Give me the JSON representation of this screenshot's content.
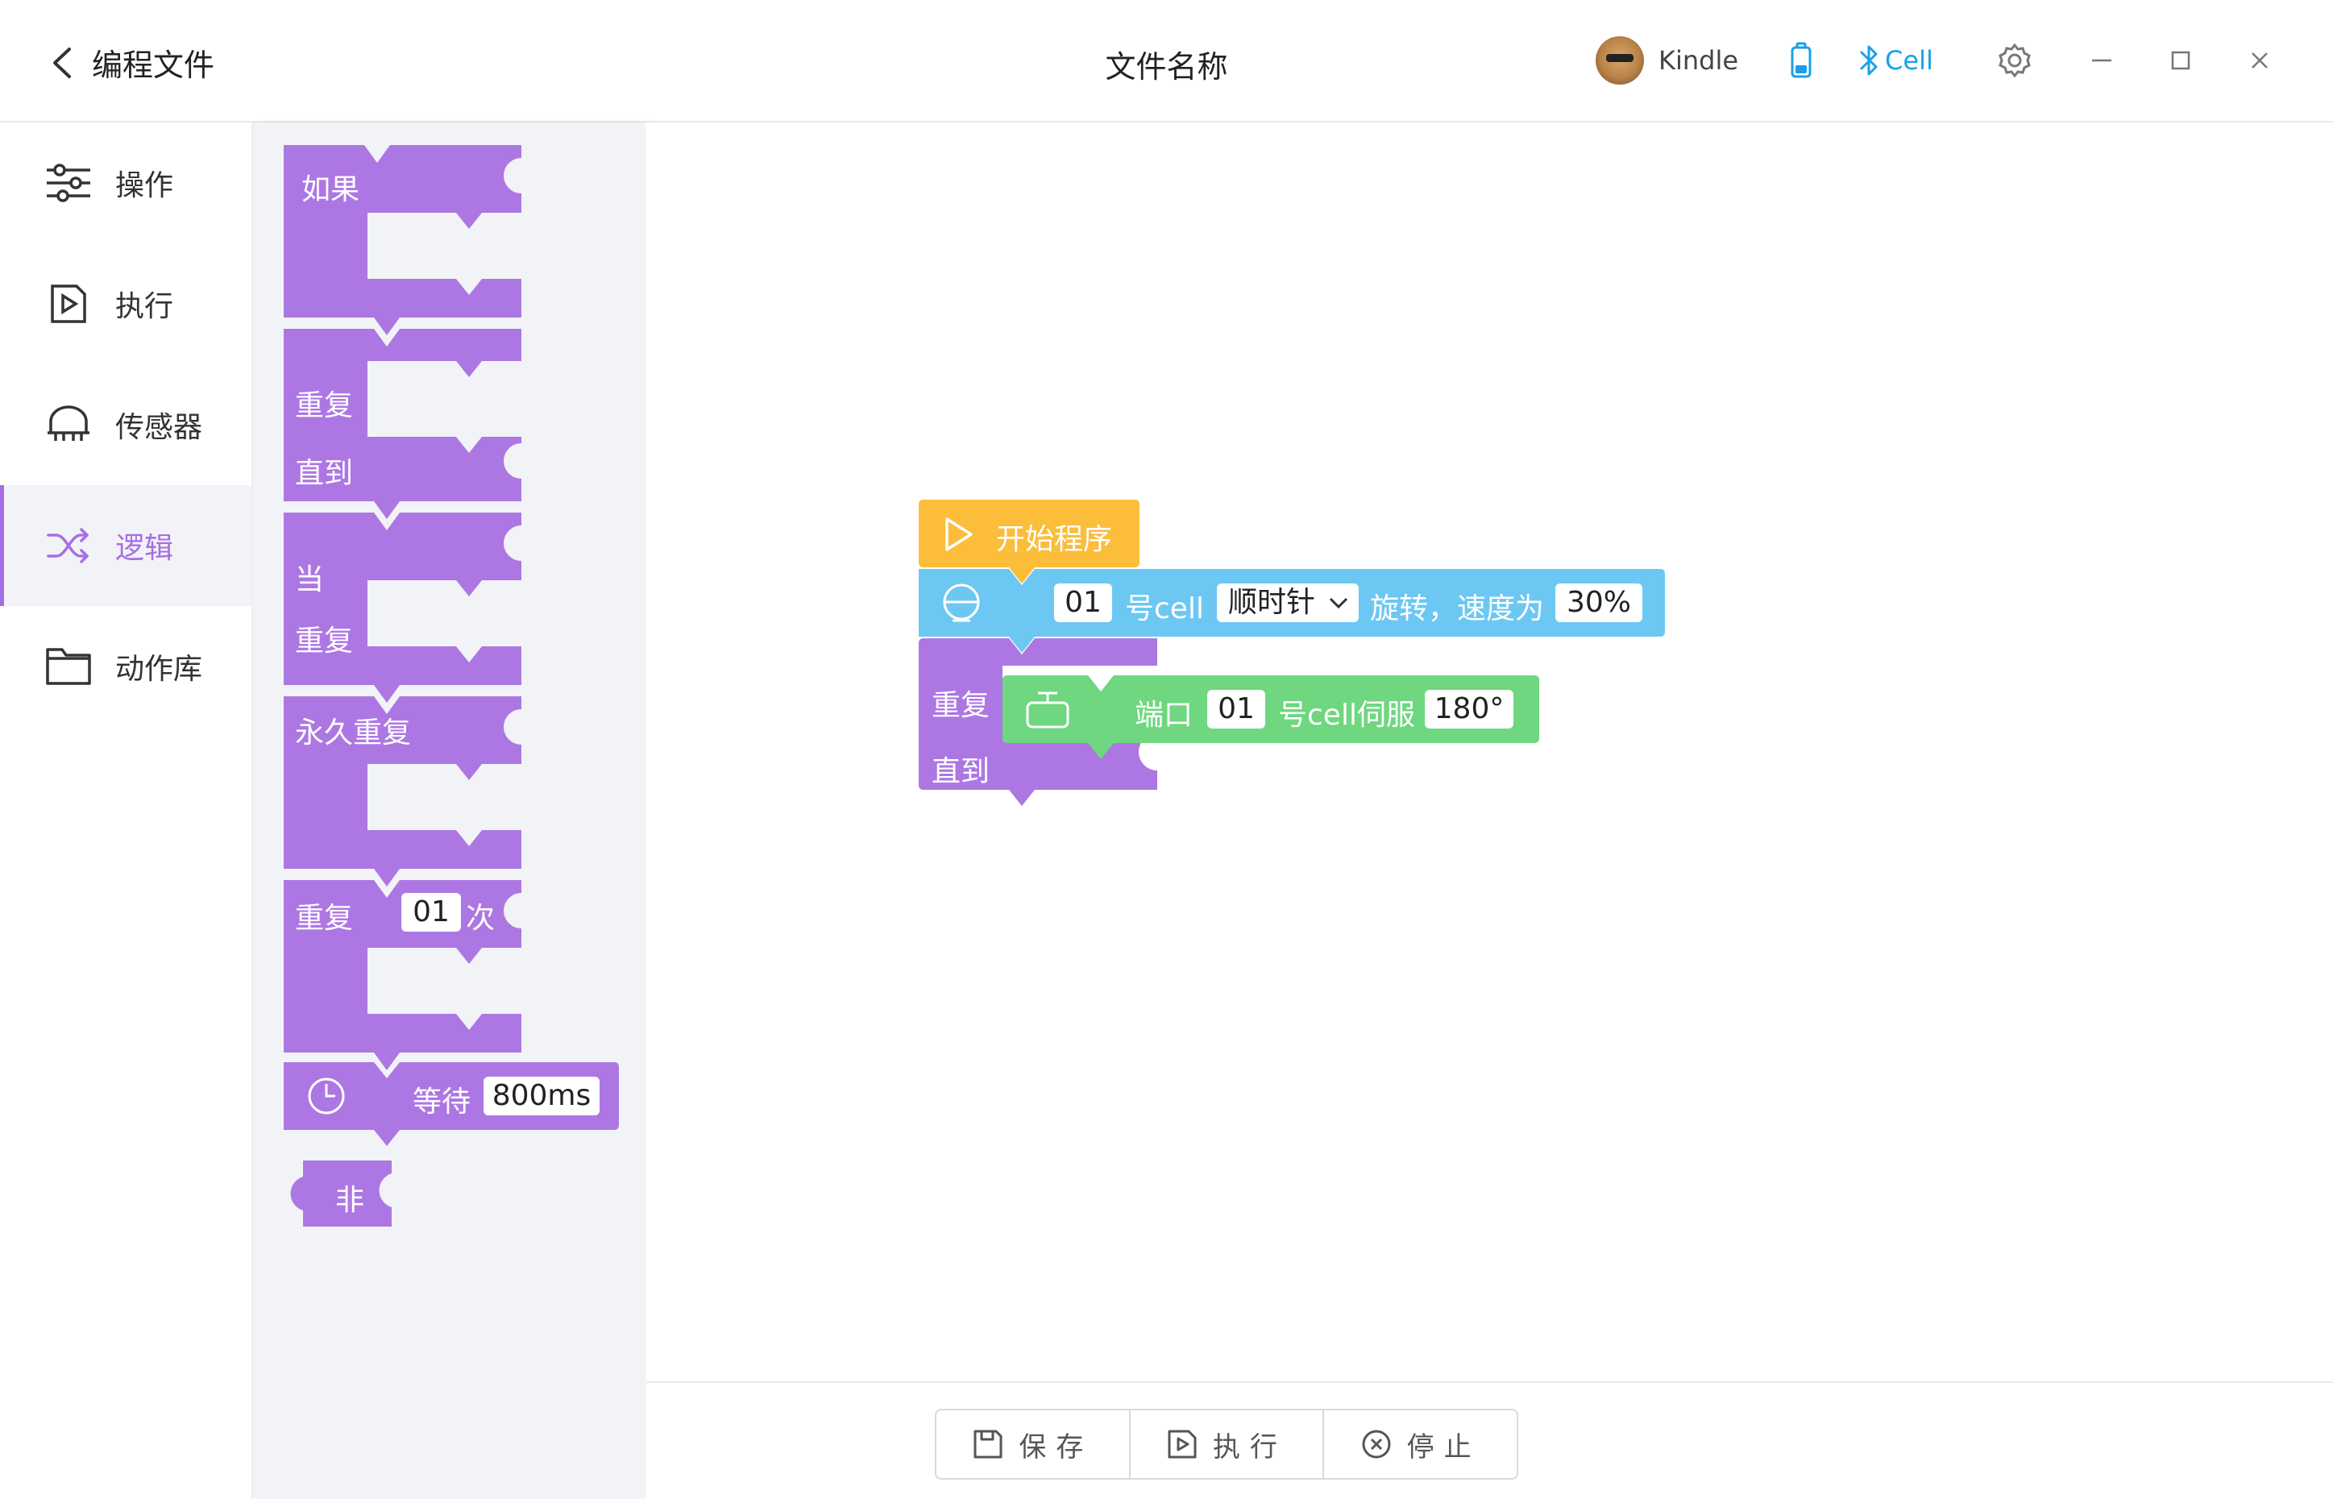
{
  "header": {
    "back_label": "编程文件",
    "title": "文件名称",
    "user_name": "Kindle",
    "device_label": "Cell"
  },
  "sidebar": {
    "items": [
      {
        "label": "操作",
        "icon": "sliders-icon"
      },
      {
        "label": "执行",
        "icon": "play-square-icon"
      },
      {
        "label": "传感器",
        "icon": "sensor-icon"
      },
      {
        "label": "逻辑",
        "icon": "shuffle-icon",
        "active": true
      },
      {
        "label": "动作库",
        "icon": "folder-icon"
      }
    ]
  },
  "palette": {
    "if_label": "如果",
    "repeat_until_repeat": "重复",
    "repeat_until_until": "直到",
    "while_when": "当",
    "while_repeat": "重复",
    "forever_label": "永久重复",
    "repeat_n_label": "重复",
    "repeat_n_value": "01",
    "repeat_n_suffix": "次",
    "wait_label": "等待",
    "wait_value": "800ms",
    "not_label": "非"
  },
  "canvas": {
    "start_label": "开始程序",
    "motor_id": "01",
    "motor_cell_label": "号cell",
    "motor_direction": "顺时针",
    "motor_rotate_label": "旋转，速度为",
    "motor_speed": "30%",
    "loop_repeat": "重复",
    "loop_until": "直到",
    "servo_port_label": "端口",
    "servo_port": "01",
    "servo_cell_label": "号cell伺服",
    "servo_angle": "180°"
  },
  "toolbar": {
    "save_label": "保存",
    "run_label": "执行",
    "stop_label": "停止"
  },
  "colors": {
    "logic_purple": "#ad77e3",
    "event_orange": "#fbbd3a",
    "motor_blue": "#6cc8f2",
    "servo_green": "#6fd77f",
    "accent_blue": "#1aa0ea",
    "active_purple": "#a66ee6"
  }
}
